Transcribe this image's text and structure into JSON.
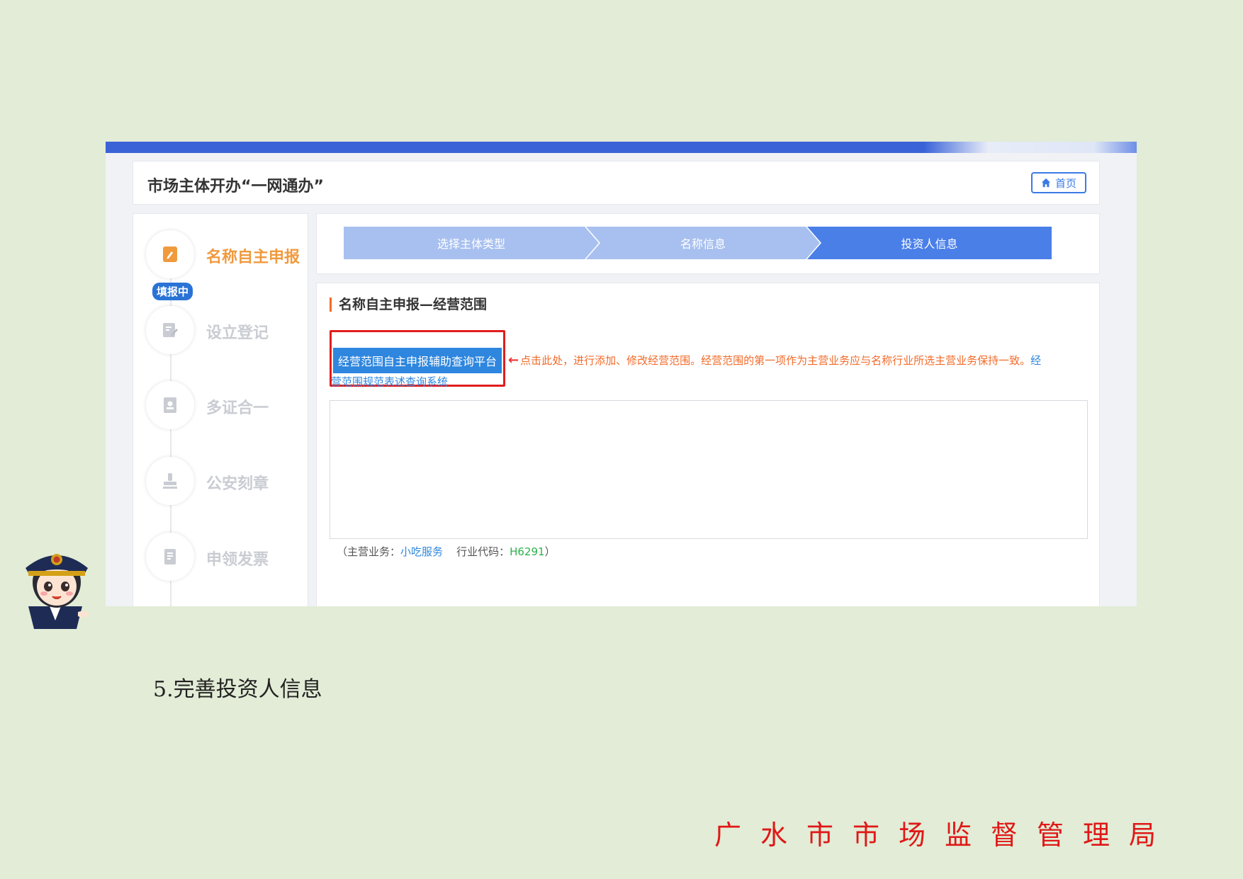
{
  "app": {
    "title": "市场主体开办“一网通办”",
    "home_label": "首页"
  },
  "sidebar": {
    "badge": "填报中",
    "items": [
      {
        "label": "名称自主申报",
        "icon": "edit-note-icon",
        "active": true
      },
      {
        "label": "设立登记",
        "icon": "register-icon",
        "active": false
      },
      {
        "label": "多证合一",
        "icon": "certificate-icon",
        "active": false
      },
      {
        "label": "公安刻章",
        "icon": "seal-icon",
        "active": false
      },
      {
        "label": "申领发票",
        "icon": "invoice-icon",
        "active": false
      }
    ]
  },
  "progress": {
    "steps": [
      {
        "label": "选择主体类型",
        "state": "done"
      },
      {
        "label": "名称信息",
        "state": "done"
      },
      {
        "label": "投资人信息",
        "state": "current"
      }
    ]
  },
  "content": {
    "section_title": "名称自主申报—经营范围",
    "platform_button": "经营范围自主申报辅助查询平台",
    "hint_text": "点击此处，进行添加、修改经营范围。经营范围的第一项作为主营业务应与名称行业所选主营业务保持一致。",
    "hint_link_start": "经",
    "hint_link_rest": "营范围规范表述查询系统",
    "main_business_label": "（主营业务：",
    "main_business_value": "小吃服务",
    "industry_code_label": "行业代码：",
    "industry_code_value": "H6291",
    "close_paren": "）"
  },
  "caption": "5.完善投资人信息",
  "footer": "广水市市场监督管理局",
  "colors": {
    "accent_blue": "#3b63d8",
    "active_orange": "#f09a3e",
    "highlight_red": "#e11d1d",
    "page_bg": "#e2ecd6"
  }
}
